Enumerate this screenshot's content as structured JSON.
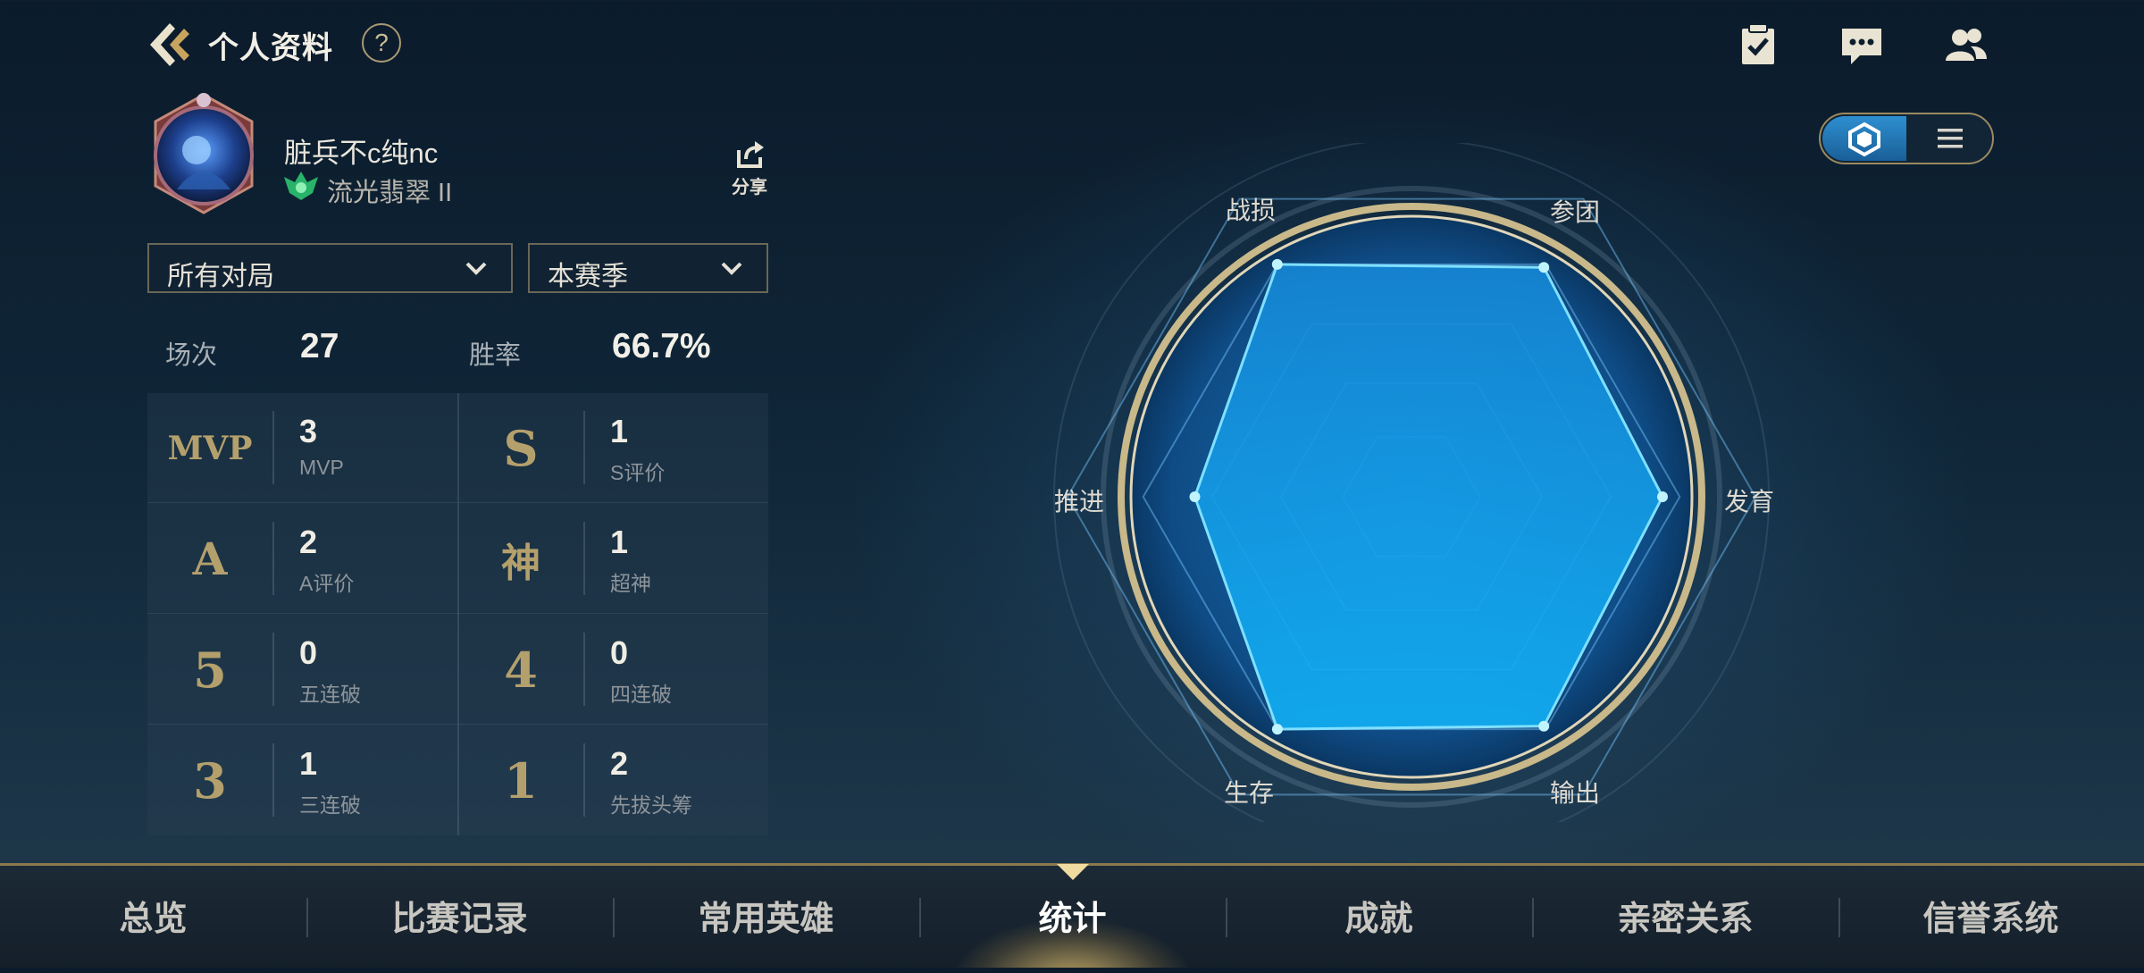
{
  "header": {
    "title": "个人资料",
    "help_label": "?"
  },
  "profile": {
    "nickname": "脏兵不c纯nc",
    "rank": "流光翡翠 II",
    "share_label": "分享"
  },
  "filters": {
    "mode": "所有对局",
    "season": "本赛季"
  },
  "summary": {
    "games_label": "场次",
    "games_value": "27",
    "winrate_label": "胜率",
    "winrate_value": "66.7%"
  },
  "stats": [
    {
      "badge": "MVP",
      "value": "3",
      "name": "MVP"
    },
    {
      "badge": "S",
      "value": "1",
      "name": "S评价"
    },
    {
      "badge": "A",
      "value": "2",
      "name": "A评价"
    },
    {
      "badge": "神",
      "value": "1",
      "name": "超神"
    },
    {
      "badge": "5",
      "value": "0",
      "name": "五连破"
    },
    {
      "badge": "4",
      "value": "0",
      "name": "四连破"
    },
    {
      "badge": "3",
      "value": "1",
      "name": "三连破"
    },
    {
      "badge": "1",
      "value": "2",
      "name": "先拔头筹"
    }
  ],
  "radar": {
    "labels": {
      "zhansun": "战损",
      "cantuan": "参团",
      "fayu": "发育",
      "shuchu": "输出",
      "shengcun": "生存",
      "tuijin": "推进"
    },
    "values": {
      "cantuan": 0.77,
      "fayu": 0.73,
      "shuchu": 0.77,
      "shengcun": 0.78,
      "tuijin": 0.63,
      "zhansun": 0.78
    }
  },
  "nav": {
    "tabs": [
      "总览",
      "比赛记录",
      "常用英雄",
      "统计",
      "成就",
      "亲密关系",
      "信誉系统"
    ],
    "active_index": 3
  },
  "colors": {
    "accent_gold": "#b4a06c",
    "radar_fill": "#1ba6f0",
    "active_toggle": "#2e8fd0"
  }
}
